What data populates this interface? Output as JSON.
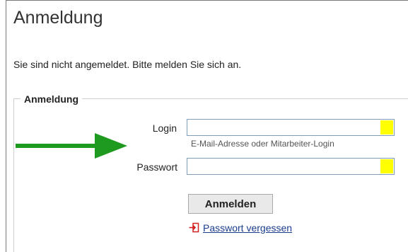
{
  "page": {
    "title": "Anmeldung",
    "info": "Sie sind nicht angemeldet. Bitte melden Sie sich an."
  },
  "form": {
    "legend": "Anmeldung",
    "login": {
      "label": "Login",
      "value": "",
      "hint": "E-Mail-Adresse oder Mitarbeiter-Login"
    },
    "password": {
      "label": "Passwort",
      "value": ""
    },
    "submit_label": "Anmelden",
    "forgot_label": "Passwort vergessen"
  },
  "icons": {
    "annotation_arrow": "arrow-right-icon",
    "forgot_link_icon": "login-arrow-icon",
    "autofill_indicator": "autofill-icon"
  },
  "colors": {
    "arrow": "#1e9a1e",
    "autofill": "#ffff00",
    "link": "#1a3c8c",
    "forgot_icon": "#d42020",
    "input_border": "#7f9db9"
  }
}
